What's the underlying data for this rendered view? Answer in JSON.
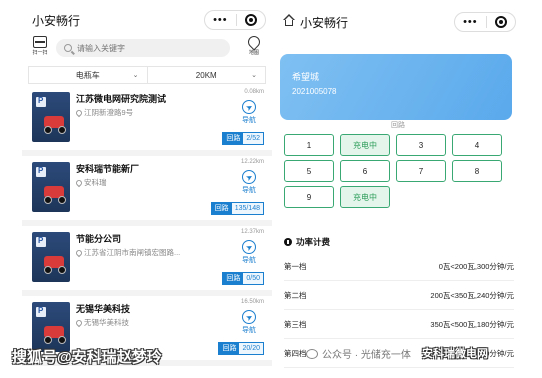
{
  "left": {
    "title": "小安畅行",
    "scan_label": "扫一扫",
    "search_placeholder": "请输入关键字",
    "map_label": "地图",
    "filters": [
      {
        "label": "电瓶车"
      },
      {
        "label": "20KM"
      }
    ],
    "stations": [
      {
        "name": "江苏微电网研究院测试",
        "address": "江阴新澄路9号",
        "distance": "0.08km",
        "nav_label": "导航",
        "route_label": "回路",
        "count": "2/52"
      },
      {
        "name": "安科瑞节能新厂",
        "address": "安科瑞",
        "distance": "12.22km",
        "nav_label": "导航",
        "route_label": "回路",
        "count": "135/148"
      },
      {
        "name": "节能分公司",
        "address": "江苏省江阴市南闸镇宏图路...",
        "distance": "12.37km",
        "nav_label": "导航",
        "route_label": "回路",
        "count": "0/50"
      },
      {
        "name": "无锡华美科技",
        "address": "无锡华美科技",
        "distance": "16.50km",
        "nav_label": "导航",
        "route_label": "回路",
        "count": "20/20"
      }
    ]
  },
  "right": {
    "title": "小安畅行",
    "card_name": "希望城",
    "card_code": "2021005078",
    "route_title": "回路",
    "ports": [
      {
        "label": "1",
        "busy": false
      },
      {
        "label": "充电中",
        "busy": true
      },
      {
        "label": "3",
        "busy": false
      },
      {
        "label": "4",
        "busy": false
      },
      {
        "label": "5",
        "busy": false
      },
      {
        "label": "6",
        "busy": false
      },
      {
        "label": "7",
        "busy": false
      },
      {
        "label": "8",
        "busy": false
      },
      {
        "label": "9",
        "busy": false
      },
      {
        "label": "充电中",
        "busy": true
      }
    ],
    "fee_title": "功率计费",
    "fees": [
      {
        "tier": "第一档",
        "price": "0瓦<200瓦,300分钟/元"
      },
      {
        "tier": "第二档",
        "price": "200瓦<350瓦,240分钟/元"
      },
      {
        "tier": "第三档",
        "price": "350瓦<500瓦,180分钟/元"
      },
      {
        "tier": "第四档",
        "price": "500瓦<1.80分钟/元"
      }
    ]
  },
  "watermarks": {
    "left": "搜狐号@安科瑞赵梦玲",
    "right_account": "公众号 · 光储充一体",
    "right_brand": "安科瑞微电网"
  },
  "colors": {
    "accent": "#1b7fcf",
    "charging_green": "#3aa873",
    "card_blue": "#6bb4ef"
  }
}
